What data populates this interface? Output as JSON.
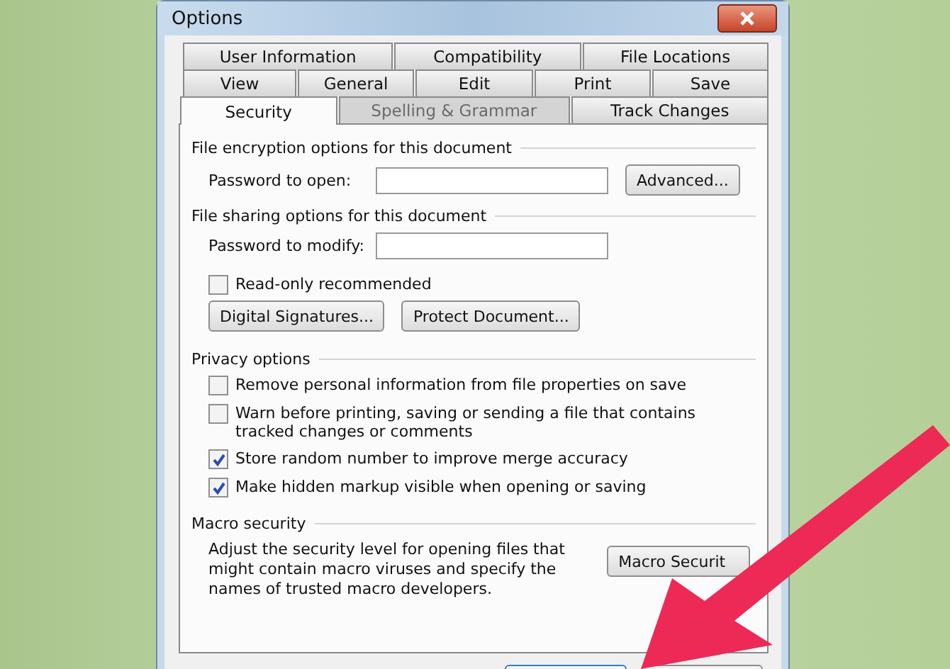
{
  "window": {
    "title": "Options"
  },
  "tab_rows": [
    [
      {
        "label": "User Information",
        "selected": false,
        "disabled": false
      },
      {
        "label": "Compatibility",
        "selected": false,
        "disabled": false
      },
      {
        "label": "File Locations",
        "selected": false,
        "disabled": false
      }
    ],
    [
      {
        "label": "View",
        "selected": false,
        "disabled": false
      },
      {
        "label": "General",
        "selected": false,
        "disabled": false
      },
      {
        "label": "Edit",
        "selected": false,
        "disabled": false
      },
      {
        "label": "Print",
        "selected": false,
        "disabled": false
      },
      {
        "label": "Save",
        "selected": false,
        "disabled": false
      }
    ],
    [
      {
        "label": "Security",
        "selected": true,
        "disabled": false
      },
      {
        "label": "Spelling & Grammar",
        "selected": false,
        "disabled": true
      },
      {
        "label": "Track Changes",
        "selected": false,
        "disabled": false
      }
    ]
  ],
  "encryption": {
    "heading": "File encryption options for this document",
    "field_label": "Password to open:",
    "button": "Advanced..."
  },
  "sharing": {
    "heading": "File sharing options for this document",
    "field_label": "Password to modify:",
    "checkbox": {
      "label": "Read-only recommended",
      "checked": false
    },
    "buttons": [
      "Digital Signatures...",
      "Protect Document..."
    ]
  },
  "privacy": {
    "heading": "Privacy options",
    "options": [
      {
        "label": "Remove personal information from file properties on save",
        "checked": false
      },
      {
        "label": "Warn before printing, saving or sending a file that contains tracked changes or comments",
        "checked": false
      },
      {
        "label": "Store random number to improve merge accuracy",
        "checked": true
      },
      {
        "label": "Make hidden markup visible when opening or saving",
        "checked": true
      }
    ]
  },
  "macro": {
    "heading": "Macro security",
    "description": "Adjust the security level for opening files that might contain macro viruses and specify the names of trusted macro developers.",
    "button": "Macro Securit"
  }
}
